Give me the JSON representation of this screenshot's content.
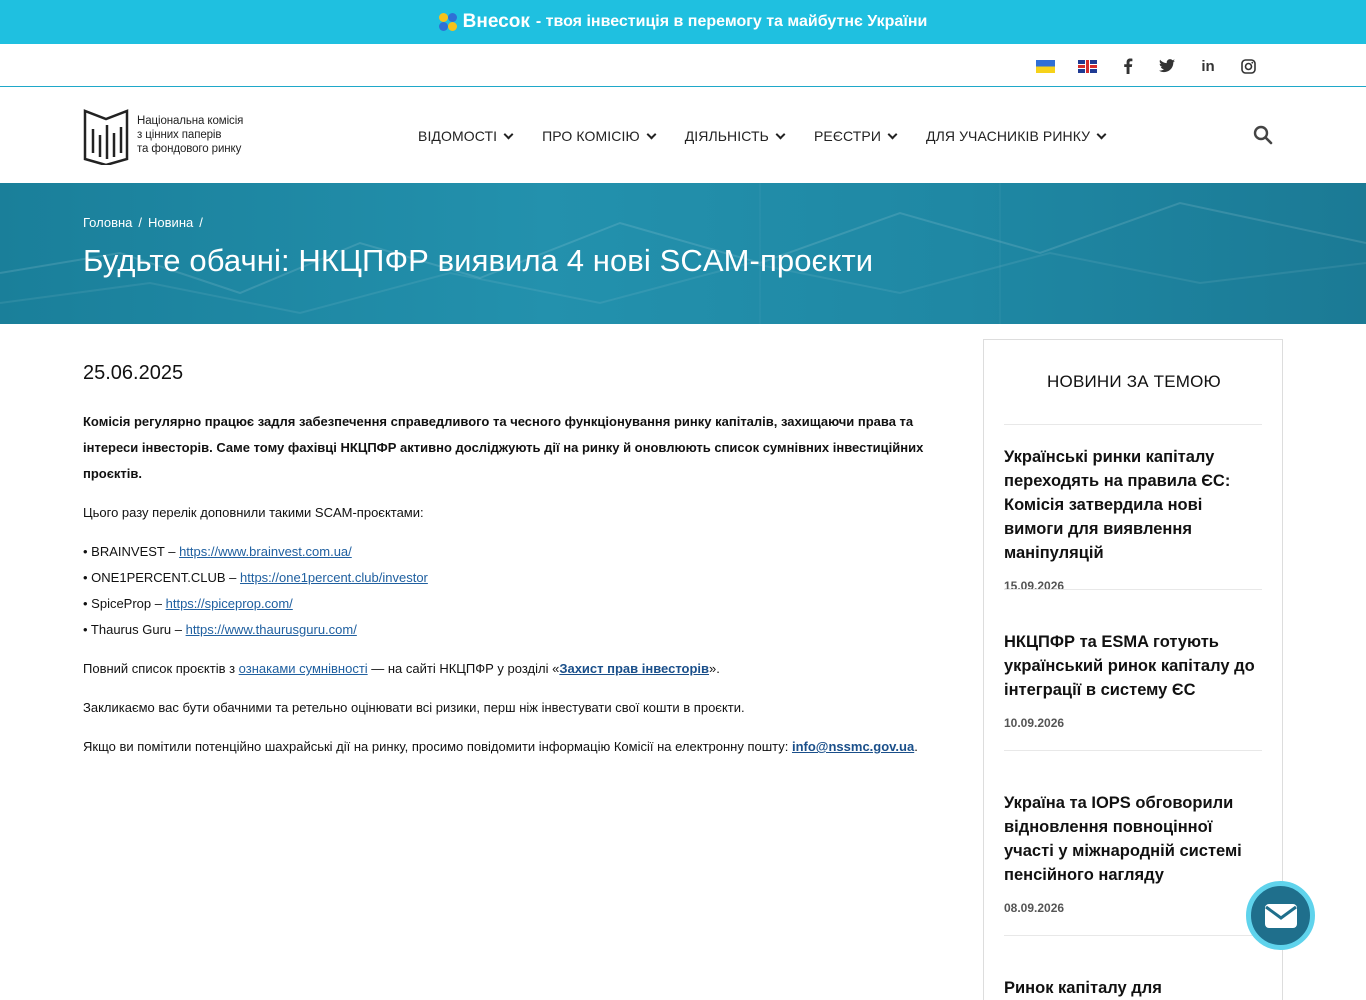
{
  "promo": {
    "brand": "Внесок",
    "text": "- твоя інвестиція в перемогу та майбутнє України"
  },
  "utility": {
    "languages": [
      "ua-flag",
      "uk-flag"
    ],
    "social": {
      "facebook": "f",
      "twitter": "twitter-bird",
      "linkedin": "in",
      "instagram": "instagram"
    }
  },
  "header": {
    "logo_lines": [
      "Національна комісія",
      "з цінних паперів",
      "та фондового ринку"
    ],
    "nav": [
      {
        "label": "ВІДОМОСТІ"
      },
      {
        "label": "ПРО КОМІСІЮ"
      },
      {
        "label": "ДІЯЛЬНІСТЬ"
      },
      {
        "label": "РЕЄСТРИ"
      },
      {
        "label": "ДЛЯ УЧАСНИКІВ РИНКУ"
      }
    ]
  },
  "hero": {
    "breadcrumb": [
      "Головна",
      "/",
      "Новина",
      "/"
    ],
    "title": "Будьте обачні: НКЦПФР виявила 4 нові SCAM-проєкти"
  },
  "article": {
    "date": "25.06.2025",
    "lead": "Комісія регулярно працює задля забезпечення справедливого та чесного функціонування ринку капіталів, захищаючи права та інтереси інвесторів. Саме тому фахівці НКЦПФР активно досліджують дії на ринку й оновлюють список сумнівних інвестиційних проєктів.",
    "intro": "Цього разу перелік доповнили такими SCAM-проєктами:",
    "items": [
      {
        "name": "• BRAINVEST – ",
        "url": "https://www.brainvest.com.ua/"
      },
      {
        "name": "• ONE1PERCENT.CLUB – ",
        "url": "https://one1percent.club/investor"
      },
      {
        "name": "• SpiceProp – ",
        "url": "https://spiceprop.com/"
      },
      {
        "name": "• Thaurus Guru – ",
        "url": "https://www.thaurusguru.com/"
      }
    ],
    "fulllist": {
      "before": "Повний список проєктів з ",
      "link1": "ознаками сумнівності",
      "middle": " — на сайті НКЦПФР у розділі «",
      "link2": "Захист прав інвесторів",
      "after": "»."
    },
    "caution": "Закликаємо вас бути обачними та ретельно оцінювати всі ризики, перш ніж інвестувати свої кошти в проєкти.",
    "report": {
      "before": "Якщо ви помітили потенційно шахрайські дії на ринку, просимо повідомити інформацію Комісії на електронну пошту: ",
      "email": "info@nssmc.gov.ua",
      "after": "."
    }
  },
  "sidebar": {
    "title": "НОВИНИ ЗА ТЕМОЮ",
    "items": [
      {
        "title": "Українські ринки капіталу переходять на правила ЄС: Комісія затвердила нові вимоги для виявлення маніпуляцій",
        "date": "15.09.2026"
      },
      {
        "title": "НКЦПФР та ESMA готують український ринок капіталу до інтеграції в систему ЄС",
        "date": "10.09.2026"
      },
      {
        "title": "Україна та IOPS обговорили відновлення повноцінної участі у міжнародній системі пенсійного нагляду",
        "date": "08.09.2026"
      },
      {
        "title": "Ринок капіталу для",
        "date": ""
      }
    ]
  },
  "colors": {
    "promo_bg": "#1fc0e0",
    "hero_bg": "#2391ad",
    "link": "#2060a0",
    "fab": "#1f6f8c"
  }
}
